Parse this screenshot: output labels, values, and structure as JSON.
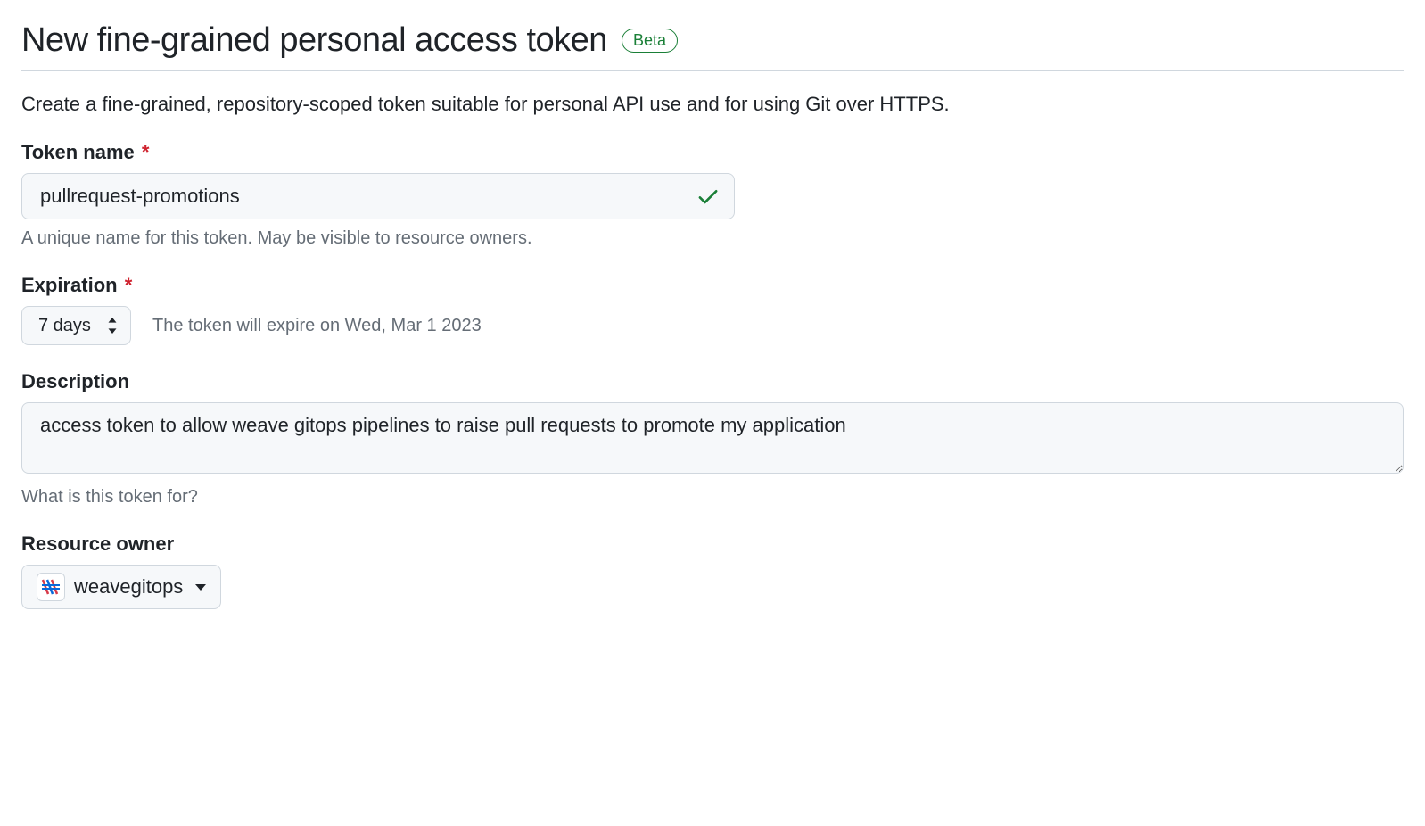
{
  "header": {
    "title": "New fine-grained personal access token",
    "badge": "Beta"
  },
  "intro": "Create a fine-grained, repository-scoped token suitable for personal API use and for using Git over HTTPS.",
  "tokenName": {
    "label": "Token name",
    "value": "pullrequest-promotions",
    "help": "A unique name for this token. May be visible to resource owners."
  },
  "expiration": {
    "label": "Expiration",
    "selected": "7 days",
    "note": "The token will expire on Wed, Mar 1 2023"
  },
  "description": {
    "label": "Description",
    "value": "access token to allow weave gitops pipelines to raise pull requests to promote my application",
    "help": "What is this token for?"
  },
  "resourceOwner": {
    "label": "Resource owner",
    "selected": "weavegitops"
  }
}
